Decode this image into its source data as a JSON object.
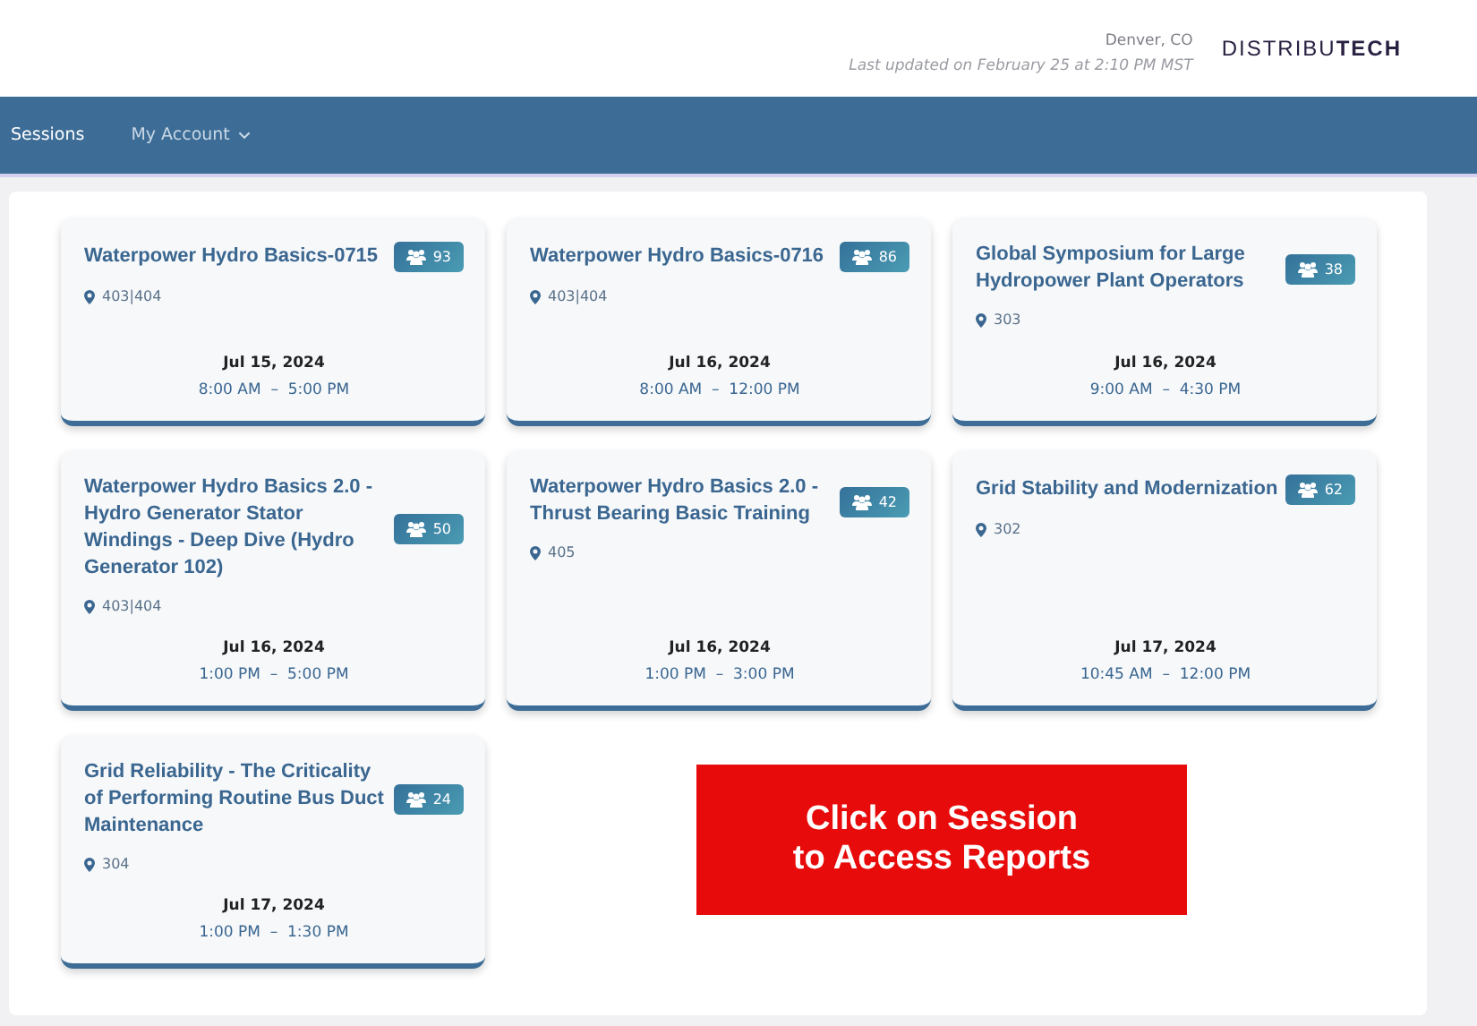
{
  "header": {
    "location": "Denver, CO",
    "last_updated": "Last updated on February 25 at 2:10 PM MST",
    "logo": {
      "light": "DISTRIBU",
      "bold": "TECH"
    }
  },
  "nav": [
    {
      "label": "Sessions",
      "selected": true,
      "dropdown": false
    },
    {
      "label": "My Account",
      "selected": false,
      "dropdown": true
    }
  ],
  "sessions": [
    {
      "title": "Waterpower Hydro Basics-0715",
      "attendees": "93",
      "room": "403|404",
      "date": "Jul 15, 2024",
      "time": "8:00 AM  –  5:00 PM"
    },
    {
      "title": "Waterpower Hydro Basics-0716",
      "attendees": "86",
      "room": "403|404",
      "date": "Jul 16, 2024",
      "time": "8:00 AM  –  12:00 PM"
    },
    {
      "title": "Global Symposium for Large Hydropower Plant Operators",
      "attendees": "38",
      "room": "303",
      "date": "Jul 16, 2024",
      "time": "9:00 AM  –  4:30 PM"
    },
    {
      "title": "Waterpower Hydro Basics 2.0 - Hydro Generator Stator Windings - Deep Dive (Hydro Generator 102)",
      "attendees": "50",
      "room": "403|404",
      "date": "Jul 16, 2024",
      "time": "1:00 PM  –  5:00 PM"
    },
    {
      "title": "Waterpower Hydro Basics 2.0 - Thrust Bearing Basic Training",
      "attendees": "42",
      "room": "405",
      "date": "Jul 16, 2024",
      "time": "1:00 PM  –  3:00 PM"
    },
    {
      "title": "Grid Stability and Modernization",
      "attendees": "62",
      "room": "302",
      "date": "Jul 17, 2024",
      "time": "10:45 AM  –  12:00 PM"
    },
    {
      "title": "Grid Reliability - The Criticality of Performing Routine Bus Duct Maintenance",
      "attendees": "24",
      "room": "304",
      "date": "Jul 17, 2024",
      "time": "1:00 PM  –  1:30 PM"
    }
  ],
  "callout": {
    "lines": [
      "Click on Session",
      "to Access Reports"
    ]
  }
}
